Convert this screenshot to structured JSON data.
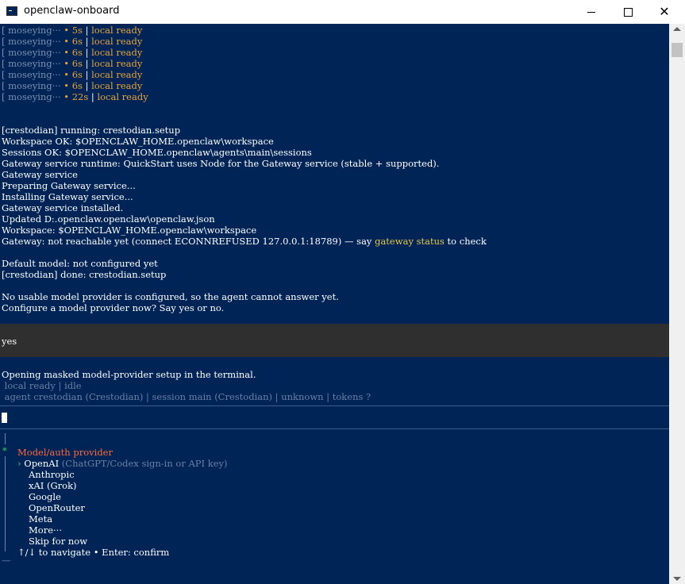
{
  "window": {
    "title": "openclaw-onboard",
    "minimize_glyph": "minimize",
    "maximize_glyph": "maximize",
    "close_glyph": "✕"
  },
  "terminal": {
    "status_rows": [
      {
        "prefix": "[ ",
        "name": "moseying···",
        "time": " • 5s ",
        "sep": "| ",
        "state": "local ready"
      },
      {
        "prefix": "[ ",
        "name": "moseying···",
        "time": " • 6s ",
        "sep": "| ",
        "state": "local ready"
      },
      {
        "prefix": "[ ",
        "name": "moseying···",
        "time": " • 6s ",
        "sep": "| ",
        "state": "local ready"
      },
      {
        "prefix": "[ ",
        "name": "moseying···",
        "time": " • 6s ",
        "sep": "| ",
        "state": "local ready"
      },
      {
        "prefix": "[ ",
        "name": "moseying···",
        "time": " • 6s ",
        "sep": "| ",
        "state": "local ready"
      },
      {
        "prefix": "[ ",
        "name": "moseying···",
        "time": " • 6s ",
        "sep": "| ",
        "state": "local ready"
      },
      {
        "prefix": "[ ",
        "name": "moseying···",
        "time": " • 22s ",
        "sep": "| ",
        "state": "local ready"
      }
    ],
    "log_lines": [
      "[crestodian] running: crestodian.setup",
      "Workspace OK: $OPENCLAW_HOME.openclaw\\workspace",
      "Sessions OK: $OPENCLAW_HOME.openclaw\\agents\\main\\sessions",
      "Gateway service runtime: QuickStart uses Node for the Gateway service (stable + supported).",
      "Gateway service",
      "Preparing Gateway service...",
      "Installing Gateway service...",
      "Gateway service installed.",
      "Updated D:.openclaw.openclaw\\openclaw.json",
      "Workspace: $OPENCLAW_HOME.openclaw\\workspace"
    ],
    "gateway_line": {
      "before": "Gateway: not reachable yet (connect ECONNREFUSED 127.0.0.1:18789) — say ",
      "command": "gateway status",
      "after": " to check"
    },
    "model_lines": [
      "Default model: not configured yet",
      "[crestodian] done: crestodian.setup"
    ],
    "prompt_lines": [
      "No usable model provider is configured, so the agent cannot answer yet.",
      "Configure a model provider now? Say yes or no."
    ],
    "user_input": "yes",
    "opening_line": "Opening masked model-provider setup in the terminal.",
    "status_bar_1": " local ready | idle",
    "status_bar_2": " agent crestodian (Crestodian) | session main (Crestodian) | unknown | tokens ?"
  },
  "provider_menu": {
    "title": "Model/auth provider",
    "pointer": "›",
    "options": [
      {
        "label": "OpenAI",
        "hint": " (ChatGPT/Codex sign-in or API key)"
      },
      {
        "label": "Anthropic",
        "hint": ""
      },
      {
        "label": "xAI (Grok)",
        "hint": ""
      },
      {
        "label": "Google",
        "hint": ""
      },
      {
        "label": "OpenRouter",
        "hint": ""
      },
      {
        "label": "Meta",
        "hint": ""
      },
      {
        "label": "More···",
        "hint": ""
      },
      {
        "label": "Skip for now",
        "hint": ""
      }
    ],
    "footer": "↑/↓ to navigate • Enter: confirm",
    "gutter_top": "|",
    "gutter_star": "*",
    "gutter_bottom": "—"
  },
  "colors": {
    "terminal_bg": "#012456",
    "accent_orange": "#e8a33a",
    "menu_title_red": "#ff6a3d",
    "selection_green": "#3ecf62"
  }
}
